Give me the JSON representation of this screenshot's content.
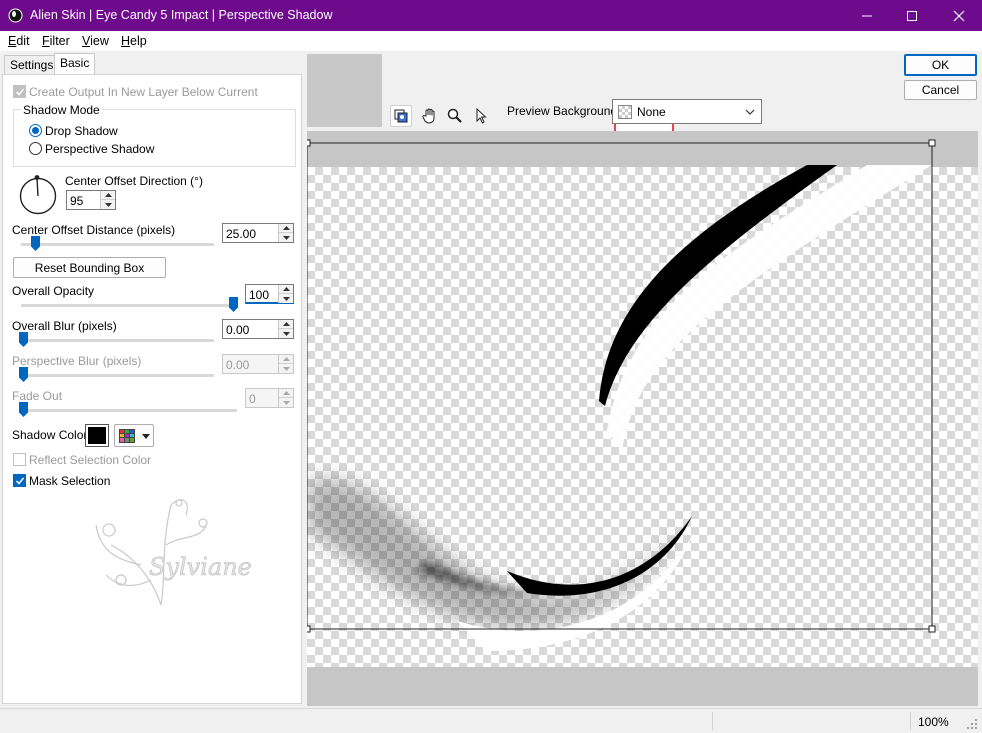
{
  "window": {
    "title": "Alien Skin | Eye Candy 5 Impact | Perspective Shadow"
  },
  "menu": {
    "items": [
      {
        "label_first": "E",
        "label_rest": "dit"
      },
      {
        "label_first": "F",
        "label_rest": "ilter"
      },
      {
        "label_first": "V",
        "label_rest": "iew"
      },
      {
        "label_first": "H",
        "label_rest": "elp"
      }
    ]
  },
  "tabs": {
    "settings": "Settings",
    "basic": "Basic"
  },
  "basic": {
    "create_output": "Create Output In New Layer Below Current",
    "shadow_mode": {
      "title": "Shadow Mode",
      "drop": "Drop Shadow",
      "perspective": "Perspective Shadow",
      "selected": "Drop Shadow"
    },
    "center_offset_direction": {
      "label": "Center Offset Direction (°)",
      "value": "95"
    },
    "center_offset_distance": {
      "label": "Center Offset Distance (pixels)",
      "value": "25.00",
      "slider_fraction": 0.1
    },
    "reset_bounding_box": "Reset Bounding Box",
    "overall_opacity": {
      "label": "Overall Opacity",
      "value": "100",
      "slider_fraction": 1.0
    },
    "overall_blur": {
      "label": "Overall Blur (pixels)",
      "value": "0.00",
      "slider_fraction": 0.0
    },
    "perspective_blur": {
      "label": "Perspective Blur (pixels)",
      "value": "0.00",
      "slider_fraction": 0.0
    },
    "fade_out": {
      "label": "Fade Out",
      "value": "0",
      "slider_fraction": 0.0
    },
    "shadow_color": {
      "label": "Shadow Color",
      "value": "#000000"
    },
    "reflect_selection_color": "Reflect Selection Color",
    "mask_selection": "Mask Selection",
    "watermark_text": "Sylviane"
  },
  "buttons": {
    "ok": "OK",
    "cancel": "Cancel"
  },
  "preview": {
    "background_label": "Preview Background:",
    "background_value": "None"
  },
  "status": {
    "zoom": "100%"
  },
  "colors": {
    "titlebar": "#6e0a8c",
    "accent": "#0067c0",
    "nav_frame": "#e8464f"
  }
}
